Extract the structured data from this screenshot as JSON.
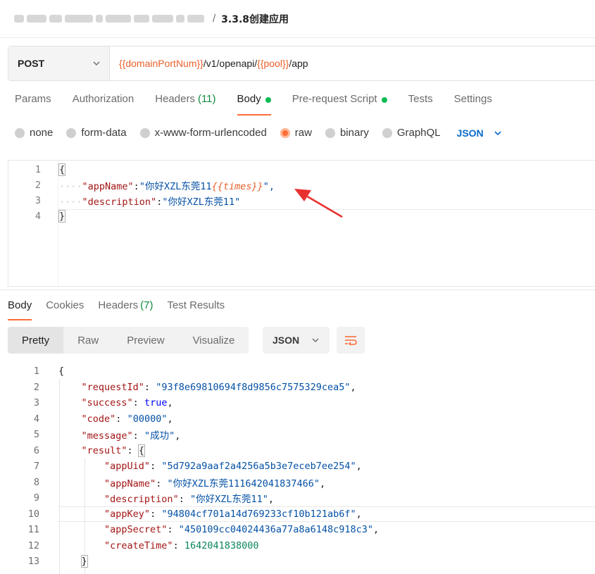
{
  "breadcrumb": {
    "title": "3.3.8创建应用",
    "separator": "/"
  },
  "request": {
    "method": "POST",
    "url_parts": [
      {
        "text": "{{domainPortNum}}",
        "var": true
      },
      {
        "text": "/v1/openapi/",
        "var": false
      },
      {
        "text": "{{pool}}",
        "var": true
      },
      {
        "text": "/app",
        "var": false
      }
    ]
  },
  "request_tabs": [
    {
      "label": "Params"
    },
    {
      "label": "Authorization"
    },
    {
      "label": "Headers",
      "count": "(11)"
    },
    {
      "label": "Body",
      "dot": true,
      "active": true
    },
    {
      "label": "Pre-request Script",
      "dot": true
    },
    {
      "label": "Tests"
    },
    {
      "label": "Settings"
    }
  ],
  "body_types": [
    {
      "label": "none"
    },
    {
      "label": "form-data"
    },
    {
      "label": "x-www-form-urlencoded"
    },
    {
      "label": "raw",
      "selected": true
    },
    {
      "label": "binary"
    },
    {
      "label": "GraphQL"
    }
  ],
  "body_format": "JSON",
  "request_body": {
    "line_numbers": [
      "1",
      "2",
      "3",
      "4"
    ],
    "open": "{",
    "close": "}",
    "key1": "\"appName\"",
    "val1_prefix": "\"你好XZL东莞11",
    "val1_var": "{{times}}",
    "val1_suffix": "\",",
    "key2": "\"description\"",
    "val2": "\"你好XZL东莞11\"",
    "indent": "····"
  },
  "response_tabs": [
    {
      "label": "Body",
      "active": true
    },
    {
      "label": "Cookies"
    },
    {
      "label": "Headers",
      "count": "(7)"
    },
    {
      "label": "Test Results"
    }
  ],
  "view_modes": [
    "Pretty",
    "Raw",
    "Preview",
    "Visualize"
  ],
  "response_format": "JSON",
  "response_lines": [
    {
      "n": "1",
      "parts": [
        [
          "p",
          "{"
        ]
      ]
    },
    {
      "n": "2",
      "parts": [
        [
          "p",
          "    "
        ],
        [
          "k",
          "\"requestId\""
        ],
        [
          "p",
          ": "
        ],
        [
          "s",
          "\"93f8e69810694f8d9856c7575329cea5\""
        ],
        [
          "p",
          ","
        ]
      ]
    },
    {
      "n": "3",
      "parts": [
        [
          "p",
          "    "
        ],
        [
          "k",
          "\"success\""
        ],
        [
          "p",
          ": "
        ],
        [
          "b",
          "true"
        ],
        [
          "p",
          ","
        ]
      ]
    },
    {
      "n": "4",
      "parts": [
        [
          "p",
          "    "
        ],
        [
          "k",
          "\"code\""
        ],
        [
          "p",
          ": "
        ],
        [
          "s",
          "\"00000\""
        ],
        [
          "p",
          ","
        ]
      ]
    },
    {
      "n": "5",
      "parts": [
        [
          "p",
          "    "
        ],
        [
          "k",
          "\"message\""
        ],
        [
          "p",
          ": "
        ],
        [
          "s",
          "\"成功\""
        ],
        [
          "p",
          ","
        ]
      ]
    },
    {
      "n": "6",
      "parts": [
        [
          "p",
          "    "
        ],
        [
          "k",
          "\"result\""
        ],
        [
          "p",
          ": "
        ],
        [
          "br",
          "{"
        ]
      ]
    },
    {
      "n": "7",
      "parts": [
        [
          "p",
          "        "
        ],
        [
          "k",
          "\"appUid\""
        ],
        [
          "p",
          ": "
        ],
        [
          "s",
          "\"5d792a9aaf2a4256a5b3e7eceb7ee254\""
        ],
        [
          "p",
          ","
        ]
      ]
    },
    {
      "n": "8",
      "parts": [
        [
          "p",
          "        "
        ],
        [
          "k",
          "\"appName\""
        ],
        [
          "p",
          ": "
        ],
        [
          "s",
          "\"你好XZL东莞111642041837466\""
        ],
        [
          "p",
          ","
        ]
      ]
    },
    {
      "n": "9",
      "parts": [
        [
          "p",
          "        "
        ],
        [
          "k",
          "\"description\""
        ],
        [
          "p",
          ": "
        ],
        [
          "s",
          "\"你好XZL东莞11\""
        ],
        [
          "p",
          ","
        ]
      ]
    },
    {
      "n": "10",
      "hl": true,
      "parts": [
        [
          "p",
          "        "
        ],
        [
          "k",
          "\"appKey\""
        ],
        [
          "p",
          ": "
        ],
        [
          "s",
          "\"94804cf701a14d769233cf10b121ab6f\""
        ],
        [
          "p",
          ","
        ]
      ]
    },
    {
      "n": "11",
      "parts": [
        [
          "p",
          "        "
        ],
        [
          "k",
          "\"appSecret\""
        ],
        [
          "p",
          ": "
        ],
        [
          "s",
          "\"450109cc04024436a77a8a6148c918c3\""
        ],
        [
          "p",
          ","
        ]
      ]
    },
    {
      "n": "12",
      "parts": [
        [
          "p",
          "        "
        ],
        [
          "k",
          "\"createTime\""
        ],
        [
          "p",
          ": "
        ],
        [
          "n",
          "1642041838000"
        ]
      ]
    },
    {
      "n": "13",
      "parts": [
        [
          "p",
          "    "
        ],
        [
          "br",
          "}"
        ]
      ]
    }
  ],
  "colors": {
    "accent": "#ff6c37",
    "dot": "#0cbb52",
    "variable": "#e8602c",
    "json_select": "#0b6bcb"
  }
}
